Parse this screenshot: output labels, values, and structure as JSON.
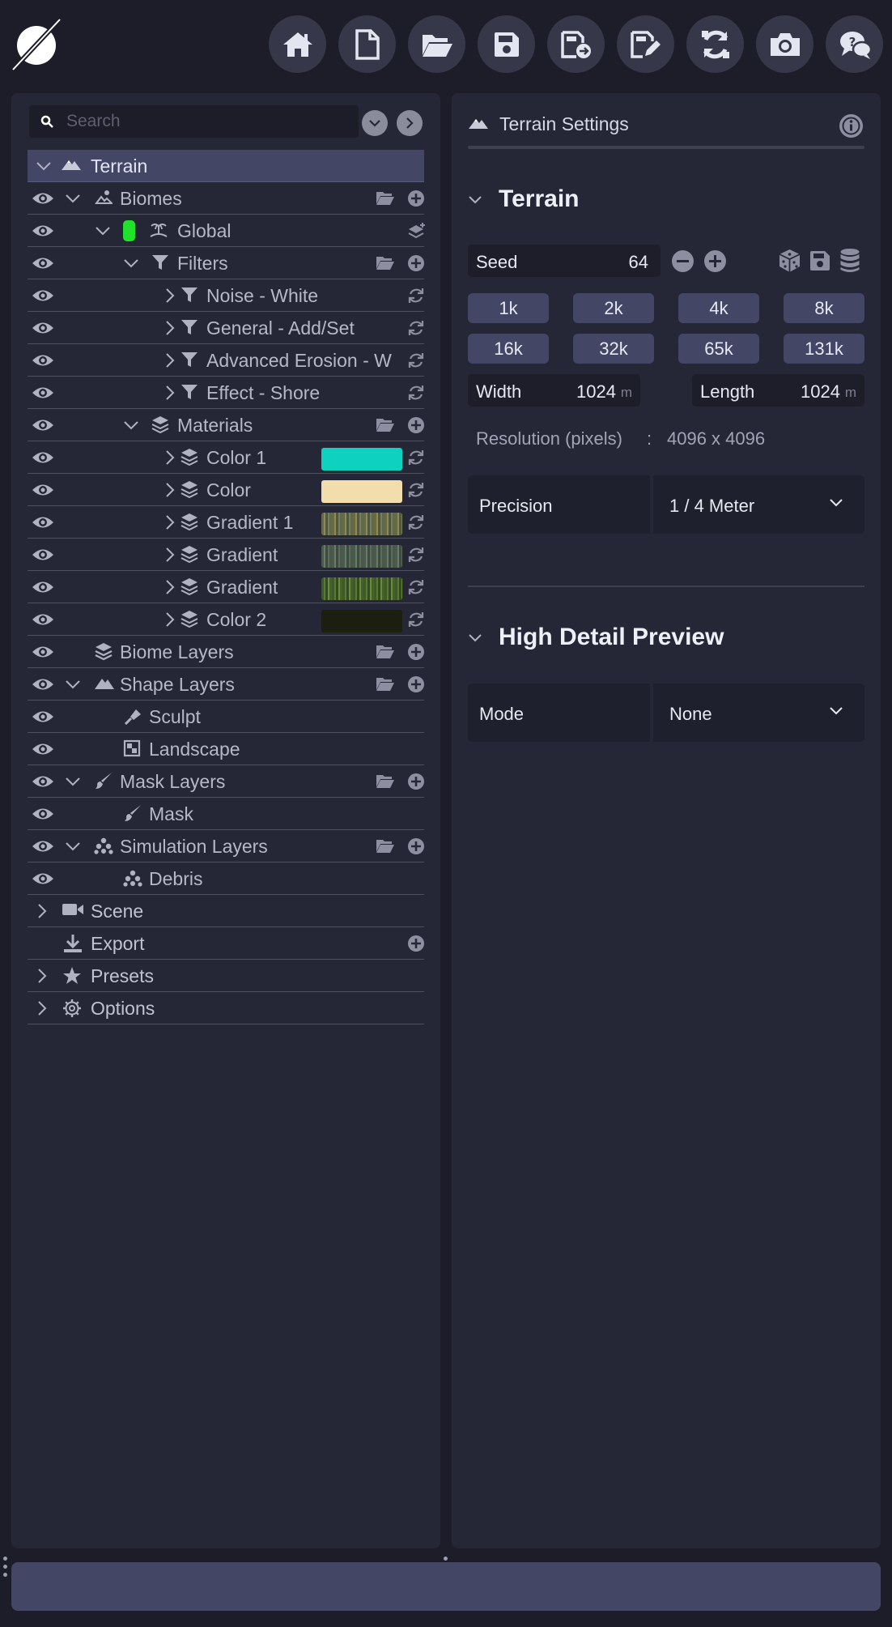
{
  "toolbar": {
    "buttons": [
      "home-icon",
      "new-file-icon",
      "open-folder-icon",
      "save-icon",
      "export-file-icon",
      "edit-file-icon",
      "sync-icon",
      "camera-icon",
      "help-chat-icon"
    ]
  },
  "search": {
    "placeholder": "Search"
  },
  "tree": {
    "terrain": "Terrain",
    "biomes": "Biomes",
    "global": "Global",
    "filters": "Filters",
    "filter_items": [
      "Noise - White",
      "General - Add/Set",
      "Advanced Erosion - W",
      "Effect - Shore"
    ],
    "materials": "Materials",
    "material_items": [
      {
        "label": "Color 1",
        "swatch": "#0ed1c0"
      },
      {
        "label": "Color",
        "swatch": "#f1deac"
      },
      {
        "label": "Gradient 1",
        "swatch": "gradient-olive"
      },
      {
        "label": "Gradient",
        "swatch": "gradient-gray-green"
      },
      {
        "label": "Gradient",
        "swatch": "gradient-green"
      },
      {
        "label": "Color 2",
        "swatch": "#1c1e0f"
      }
    ],
    "biome_layers": "Biome Layers",
    "shape_layers": "Shape Layers",
    "sculpt": "Sculpt",
    "landscape": "Landscape",
    "mask_layers": "Mask Layers",
    "mask": "Mask",
    "simulation_layers": "Simulation Layers",
    "debris": "Debris",
    "scene": "Scene",
    "export": "Export",
    "presets": "Presets",
    "options": "Options"
  },
  "settings": {
    "header": "Terrain Settings",
    "terrain_section": "Terrain",
    "seed_label": "Seed",
    "seed_value": "64",
    "sizes": [
      "1k",
      "2k",
      "4k",
      "8k",
      "16k",
      "32k",
      "65k",
      "131k"
    ],
    "width_label": "Width",
    "width_value": "1024",
    "length_label": "Length",
    "length_value": "1024",
    "unit": "m",
    "resolution_label": "Resolution (pixels)",
    "resolution_sep": ":",
    "resolution_value": "4096 x 4096",
    "precision_label": "Precision",
    "precision_value": "1 / 4 Meter",
    "preview_section": "High Detail Preview",
    "mode_label": "Mode",
    "mode_value": "None"
  },
  "colors": {
    "background": "#1c1d29",
    "panel": "#262736",
    "accent": "#434665",
    "green_tag": "#21e22a"
  }
}
